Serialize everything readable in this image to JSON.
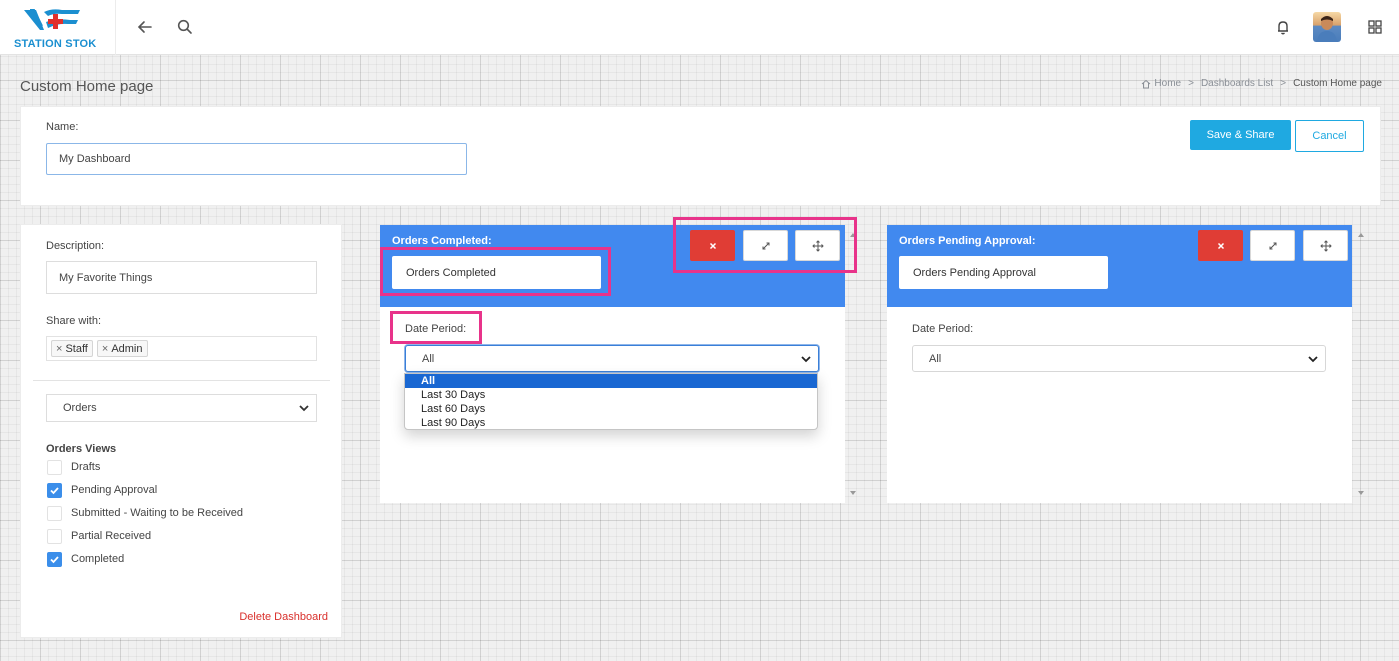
{
  "app": {
    "name": "STATION STOK"
  },
  "header": {
    "icons": [
      "back-arrow-icon",
      "search-icon",
      "bell-icon",
      "avatar",
      "grid-menu-icon"
    ]
  },
  "page": {
    "title": "Custom Home page",
    "breadcrumb": {
      "home": "Home",
      "sep": ">",
      "list": "Dashboards List",
      "current": "Custom Home page"
    }
  },
  "form": {
    "name_label": "Name:",
    "name_value": "My Dashboard",
    "save_label": "Save & Share",
    "cancel_label": "Cancel"
  },
  "sidebar": {
    "description_label": "Description:",
    "description_value": "My Favorite Things",
    "share_label": "Share with:",
    "share_tags": [
      "Staff",
      "Admin"
    ],
    "views_select": "Orders",
    "views_heading": "Orders Views",
    "views": [
      {
        "label": "Drafts",
        "checked": false
      },
      {
        "label": "Pending Approval",
        "checked": true
      },
      {
        "label": "Submitted - Waiting to be Received",
        "checked": false
      },
      {
        "label": "Partial Received",
        "checked": false
      },
      {
        "label": "Completed",
        "checked": true
      }
    ],
    "delete_label": "Delete Dashboard"
  },
  "widgets": [
    {
      "title": "Orders Completed:",
      "name_value": "Orders Completed",
      "period_label": "Date Period:",
      "period_value": "All",
      "dropdown_open": true,
      "options": [
        "All",
        "Last 30 Days",
        "Last 60 Days",
        "Last 90 Days"
      ]
    },
    {
      "title": "Orders Pending Approval:",
      "name_value": "Orders Pending Approval",
      "period_label": "Date Period:",
      "period_value": "All",
      "dropdown_open": false
    }
  ],
  "colors": {
    "brand": "#1b8fd0",
    "widget_header": "#4189ef",
    "delete_red": "#e03d35",
    "save_blue": "#1fa9e1",
    "highlight": "#e8338a",
    "danger_text": "#d9302c"
  }
}
